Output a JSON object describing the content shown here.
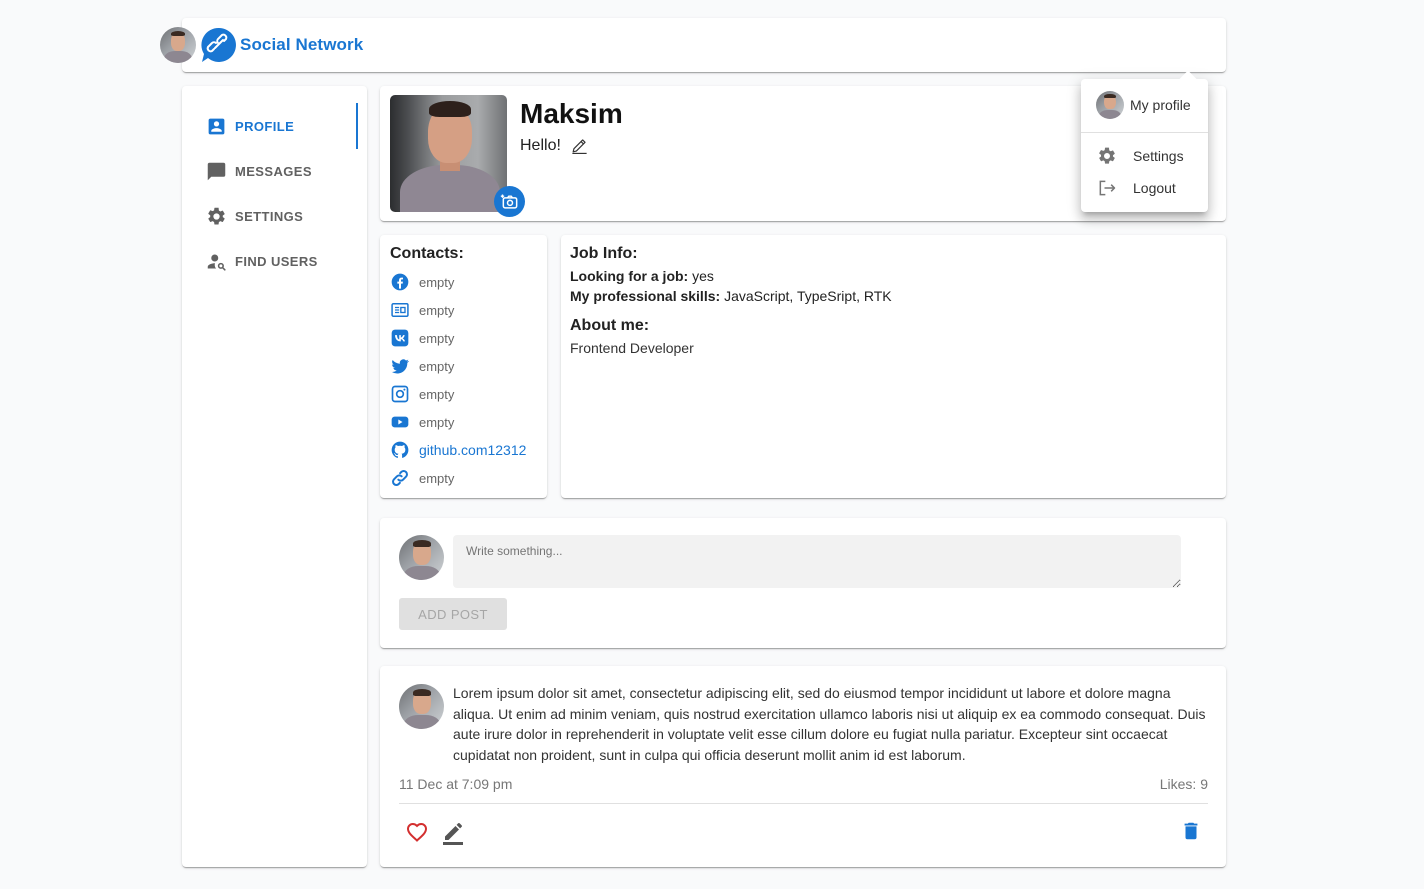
{
  "colors": {
    "accent": "#1976d2",
    "like": "#d32f2f",
    "background": "#f9fafb"
  },
  "header": {
    "app_title": "Social Network",
    "logo_icon": "link-chat-icon"
  },
  "sidebar": {
    "items": [
      {
        "label": "PROFILE",
        "icon": "account-box-icon",
        "active": true
      },
      {
        "label": "MESSAGES",
        "icon": "message-icon",
        "active": false
      },
      {
        "label": "SETTINGS",
        "icon": "gear-icon",
        "active": false
      },
      {
        "label": "FIND USERS",
        "icon": "person-search-icon",
        "active": false
      }
    ]
  },
  "profile": {
    "name": "Maksim",
    "status": "Hello!"
  },
  "menu": {
    "my_profile": "My profile",
    "settings": "Settings",
    "logout": "Logout"
  },
  "contacts": {
    "title": "Contacts:",
    "items": [
      {
        "icon": "facebook-icon",
        "value": "empty"
      },
      {
        "icon": "website-icon",
        "value": "empty"
      },
      {
        "icon": "vk-icon",
        "value": "empty"
      },
      {
        "icon": "twitter-icon",
        "value": "empty"
      },
      {
        "icon": "instagram-icon",
        "value": "empty"
      },
      {
        "icon": "youtube-icon",
        "value": "empty"
      },
      {
        "icon": "github-icon",
        "value": "github.com12312"
      },
      {
        "icon": "link-icon",
        "value": "empty"
      }
    ]
  },
  "job": {
    "title": "Job Info:",
    "looking_label": "Looking for a job:",
    "looking_value": "yes",
    "skills_label": "My professional skills:",
    "skills_value": "JavaScript, TypeSript, RTK",
    "about_title": "About me:",
    "about_value": "Frontend Developer"
  },
  "new_post": {
    "placeholder": "Write something...",
    "button": "ADD POST"
  },
  "post": {
    "text": "Lorem ipsum dolor sit amet, consectetur adipiscing elit, sed do eiusmod tempor incididunt ut labore et dolore magna aliqua. Ut enim ad minim veniam, quis nostrud exercitation ullamco laboris nisi ut aliquip ex ea commodo consequat. Duis aute irure dolor in reprehenderit in voluptate velit esse cillum dolore eu fugiat nulla pariatur. Excepteur sint occaecat cupidatat non proident, sunt in culpa qui officia deserunt mollit anim id est laborum.",
    "date": "11 Dec at 7:09 pm",
    "likes": "Likes: 9"
  }
}
